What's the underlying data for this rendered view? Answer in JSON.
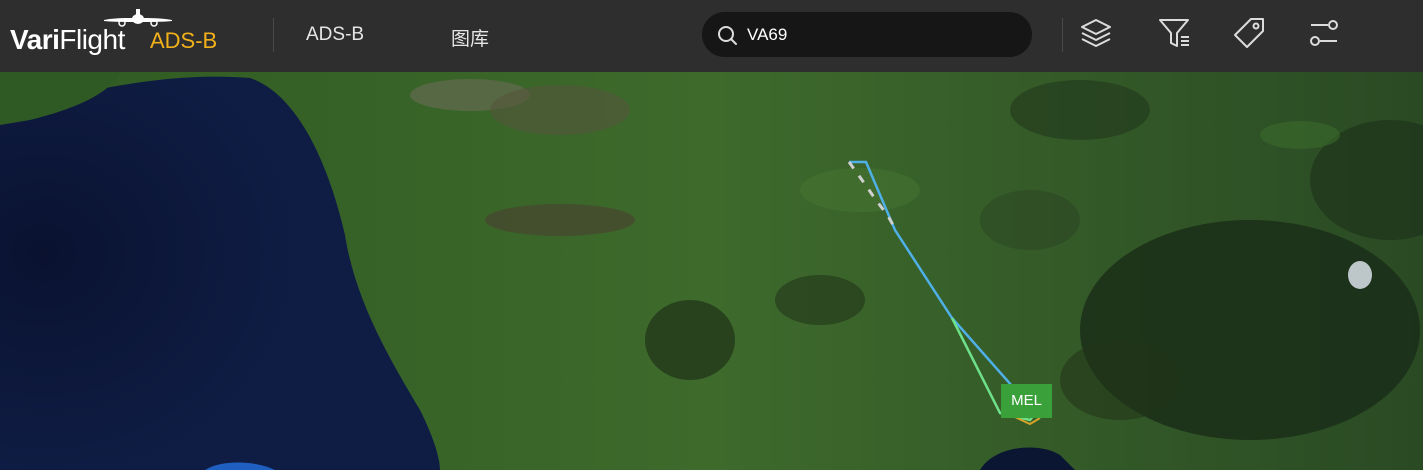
{
  "header": {
    "brand_bold": "Vari",
    "brand_light": "Flight",
    "product": "ADS-B",
    "nav": [
      {
        "label": "ADS-B"
      },
      {
        "label": "图库"
      }
    ],
    "search": {
      "value": "VA69"
    },
    "tools": [
      {
        "icon": "layers-icon"
      },
      {
        "icon": "filter-icon"
      },
      {
        "icon": "tag-icon"
      },
      {
        "icon": "settings-sliders-icon"
      }
    ]
  },
  "map": {
    "airport_label": "MEL",
    "track_colors": [
      "#4fb0e8",
      "#6fe08a",
      "#cfcfcf"
    ],
    "airport_label_color": "#3aa13a"
  }
}
